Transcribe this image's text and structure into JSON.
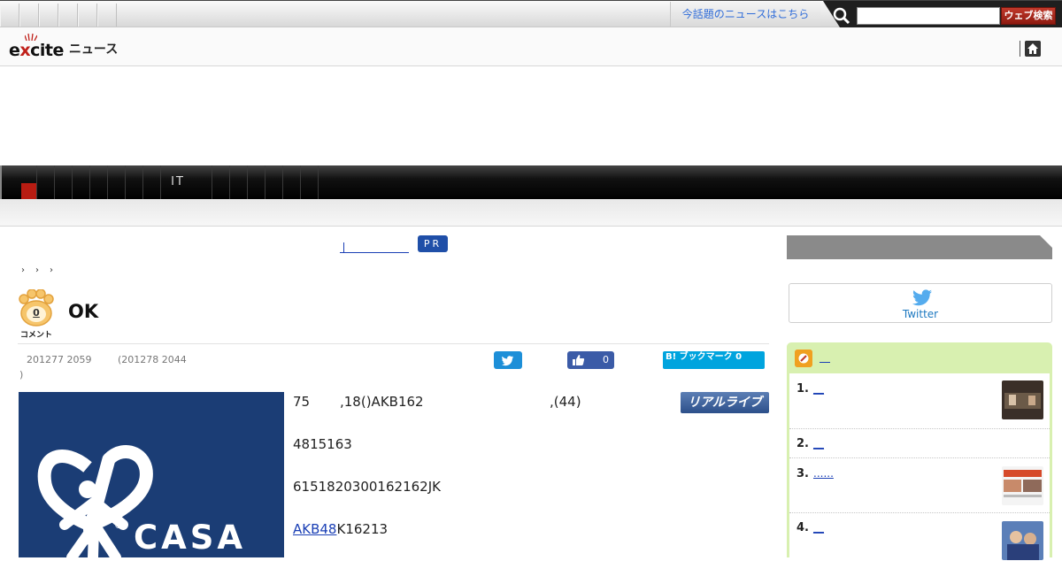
{
  "topbar": {
    "news_link": "今話題のニュースはこちら",
    "search_placeholder": "",
    "search_button": "ウェブ検索"
  },
  "logo": {
    "brand": "excite",
    "section": "ニュース"
  },
  "nav": {
    "it_label": "IT"
  },
  "pr": {
    "badge": "PR"
  },
  "breadcrumb": {
    "separators": [
      "›",
      "›",
      "›"
    ]
  },
  "article": {
    "comment_count": "0",
    "comment_label": "コメント",
    "title": "OK",
    "published": "201277 2059",
    "updated": "(201278 2044",
    "updated_close": ")",
    "share": {
      "like_count": "0",
      "hatena_label": "B! ブックマーク 0"
    },
    "body": {
      "p1_start": "75",
      "p1_mid": ",18()AKB162",
      "p1_end": ",(44)",
      "p2": "4815163",
      "p3": "6151820300162162JK",
      "p4_link": "AKB48",
      "p4_rest": "K16213"
    },
    "image_brand": "CASA",
    "reallive_label": "リアルライブ"
  },
  "sidebar": {
    "twitter_label": "Twitter",
    "ranking": {
      "items": [
        {
          "num": "1.",
          "link": "__"
        },
        {
          "num": "2.",
          "link": "__"
        },
        {
          "num": "3.",
          "link": "......"
        },
        {
          "num": "4.",
          "link": "__"
        }
      ]
    }
  },
  "colors": {
    "accent_red": "#b81c12",
    "link_blue": "#1a3fb5",
    "ranking_bg": "#d8f0b0",
    "image_bg": "#1b3d75"
  }
}
